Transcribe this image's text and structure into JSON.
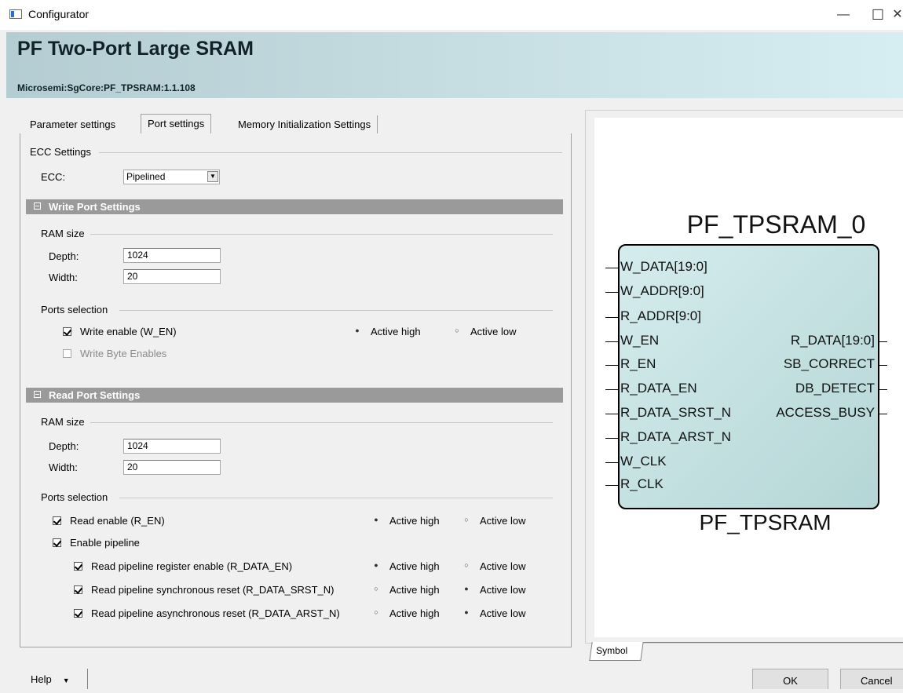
{
  "window": {
    "title": "Configurator",
    "minimize": "—",
    "maximize": "☐",
    "close": "✕"
  },
  "header": {
    "title": "PF Two-Port Large SRAM",
    "vlnv": "Microsemi:SgCore:PF_TPSRAM:1.1.108"
  },
  "tabs": [
    "Parameter settings",
    "Port settings",
    "Memory Initialization Settings"
  ],
  "active_tab": "Port settings",
  "ecc": {
    "group_label": "ECC Settings",
    "field_label": "ECC:",
    "value": "Pipelined"
  },
  "write_port": {
    "section_title": "Write Port Settings",
    "ram_size_label": "RAM size",
    "depth_label": "Depth:",
    "depth_value": "1024",
    "width_label": "Width:",
    "width_value": "20",
    "ports_selection_label": "Ports selection",
    "write_enable_label": "Write enable (W_EN)",
    "write_enable_checked": true,
    "active_high_label": "Active high",
    "active_low_label": "Active low",
    "byte_enables_label": "Write Byte Enables",
    "byte_enables_checked": false
  },
  "read_port": {
    "section_title": "Read Port Settings",
    "ram_size_label": "RAM size",
    "depth_label": "Depth:",
    "depth_value": "1024",
    "width_label": "Width:",
    "width_value": "20",
    "ports_selection_label": "Ports selection",
    "read_enable_label": "Read enable (R_EN)",
    "enable_pipeline_label": "Enable pipeline",
    "rows": [
      {
        "label": "Read pipeline register enable (R_DATA_EN)",
        "active": "high"
      },
      {
        "label": "Read pipeline synchronous reset (R_DATA_SRST_N)",
        "active": "low"
      },
      {
        "label": "Read pipeline asynchronous reset (R_DATA_ARST_N)",
        "active": "low"
      }
    ],
    "active_high_label": "Active high",
    "active_low_label": "Active low"
  },
  "symbol": {
    "instance_name": "PF_TPSRAM_0",
    "component_name": "PF_TPSRAM",
    "inputs": [
      "W_DATA[19:0]",
      "W_ADDR[9:0]",
      "R_ADDR[9:0]",
      "W_EN",
      "R_EN",
      "R_DATA_EN",
      "R_DATA_SRST_N",
      "R_DATA_ARST_N",
      "W_CLK",
      "R_CLK"
    ],
    "outputs": [
      "R_DATA[19:0]",
      "SB_CORRECT",
      "DB_DETECT",
      "ACCESS_BUSY"
    ],
    "tab_label": "Symbol"
  },
  "buttons": {
    "help": "Help",
    "ok": "OK",
    "cancel": "Cancel"
  }
}
